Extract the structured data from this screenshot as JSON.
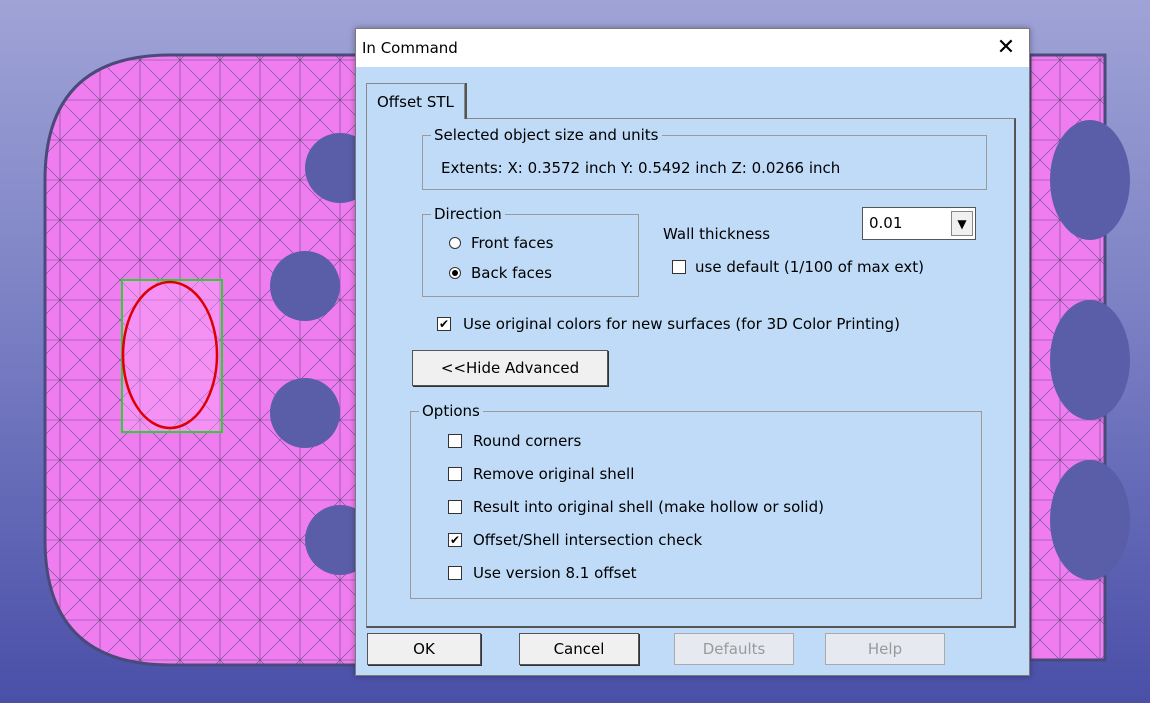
{
  "dialog": {
    "title": "In Command",
    "close_glyph": "✕",
    "tab_label": "Offset STL",
    "extents_group": {
      "legend": "Selected object size and units",
      "extents_text": "Extents:  X: 0.3572 inch   Y: 0.5492 inch   Z: 0.0266 inch"
    },
    "direction_group": {
      "legend": "Direction",
      "front_label": "Front faces",
      "back_label": "Back faces",
      "selected": "Back faces"
    },
    "wall_thickness": {
      "label": "Wall thickness",
      "value": "0.01",
      "use_default_label": "use default (1/100 of max ext)",
      "use_default_checked": false
    },
    "use_original_colors": {
      "label": "Use original colors for new surfaces (for 3D Color Printing)",
      "checked": true
    },
    "hide_advanced_label": "<<Hide Advanced",
    "options_group": {
      "legend": "Options",
      "items": [
        {
          "label": "Round corners",
          "checked": false
        },
        {
          "label": "Remove original shell",
          "checked": false
        },
        {
          "label": "Result into original shell (make hollow or solid)",
          "checked": false
        },
        {
          "label": "Offset/Shell intersection check",
          "checked": true
        },
        {
          "label": "Use version 8.1 offset",
          "checked": false
        }
      ]
    },
    "buttons": {
      "ok": "OK",
      "cancel": "Cancel",
      "defaults": "Defaults",
      "help": "Help"
    }
  },
  "colors": {
    "model_fill": "#f07df0",
    "model_edge": "#4a4a7a",
    "selection_ellipse": "#dd0000",
    "selection_box": "#33cc33",
    "dialog_bg": "#bfdbf7"
  }
}
